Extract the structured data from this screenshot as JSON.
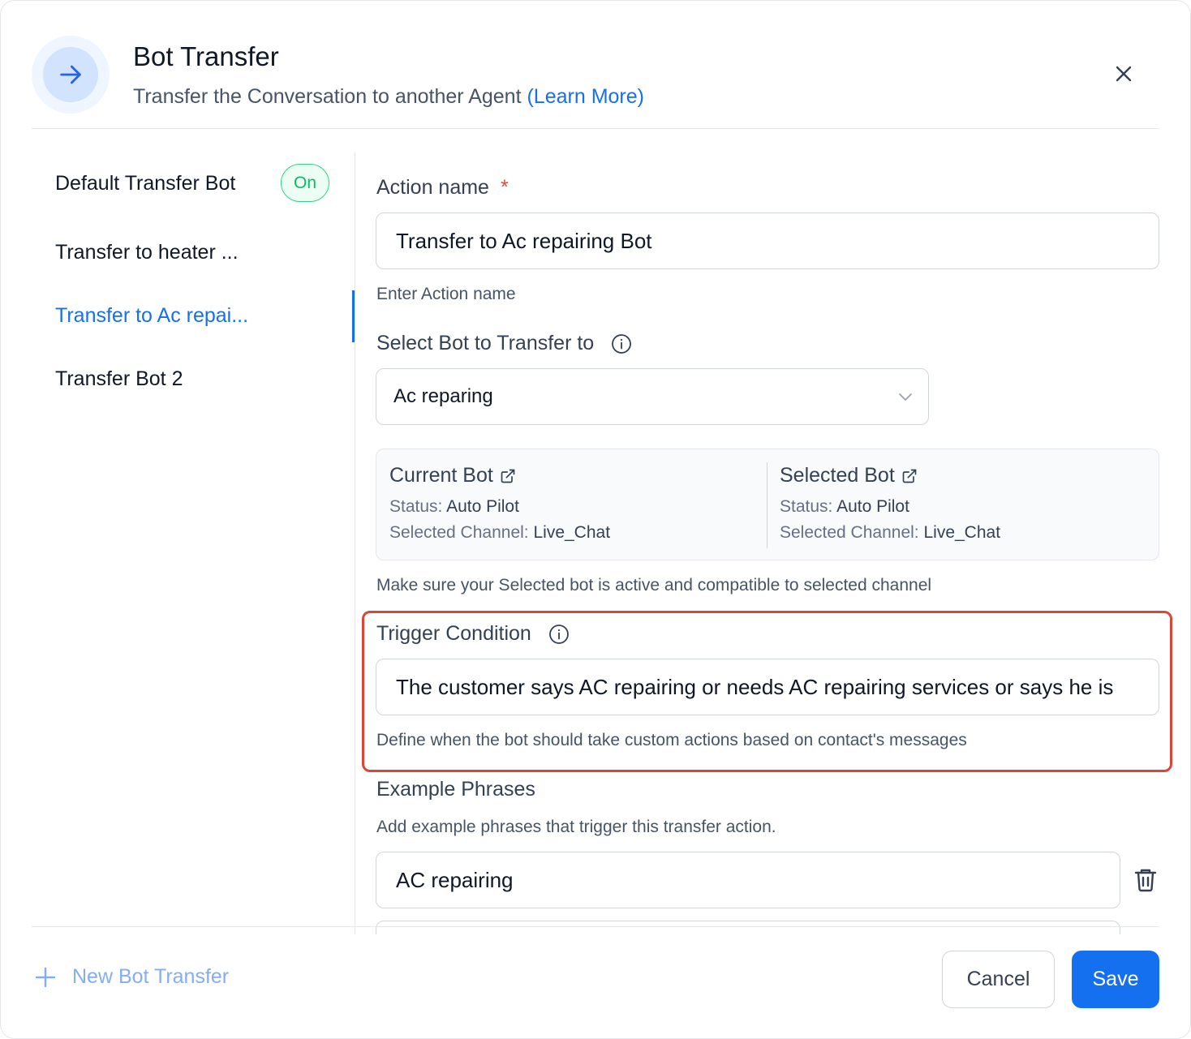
{
  "header": {
    "title": "Bot Transfer",
    "subtitle": "Transfer the Conversation to another Agent",
    "learn_more": "(Learn More)",
    "icon": "arrow-right-icon",
    "close_icon": "close-icon"
  },
  "sidebar": {
    "items": [
      {
        "label": "Default Transfer Bot",
        "toggle": "On"
      },
      {
        "label": "Transfer to heater ..."
      },
      {
        "label": "Transfer to Ac repai...",
        "active": true
      },
      {
        "label": "Transfer Bot 2"
      }
    ],
    "new_button": "New Bot Transfer"
  },
  "form": {
    "action_name": {
      "label": "Action name",
      "required": "*",
      "value": "Transfer to Ac repairing Bot",
      "hint": "Enter Action name"
    },
    "select_bot": {
      "label": "Select Bot to Transfer to",
      "value": "Ac reparing"
    },
    "bot_info": {
      "current": {
        "title": "Current Bot",
        "status_label": "Status:",
        "status": "Auto Pilot",
        "channel_label": "Selected Channel:",
        "channel": "Live_Chat"
      },
      "selected": {
        "title": "Selected Bot",
        "status_label": "Status:",
        "status": "Auto Pilot",
        "channel_label": "Selected Channel:",
        "channel": "Live_Chat"
      },
      "note": "Make sure your Selected bot is active and compatible to selected channel"
    },
    "trigger": {
      "label": "Trigger Condition",
      "value": "The customer says AC repairing or needs AC repairing services or says he is",
      "hint": "Define when the bot should take custom actions based on contact's messages"
    },
    "example_phrases": {
      "label": "Example Phrases",
      "hint": "Add example phrases that trigger this transfer action.",
      "items": [
        "AC repairing"
      ]
    }
  },
  "footer": {
    "cancel": "Cancel",
    "save": "Save"
  },
  "colors": {
    "accent": "#1570ef",
    "toggle_green": "#12b76a",
    "highlight": "#d9473b"
  }
}
